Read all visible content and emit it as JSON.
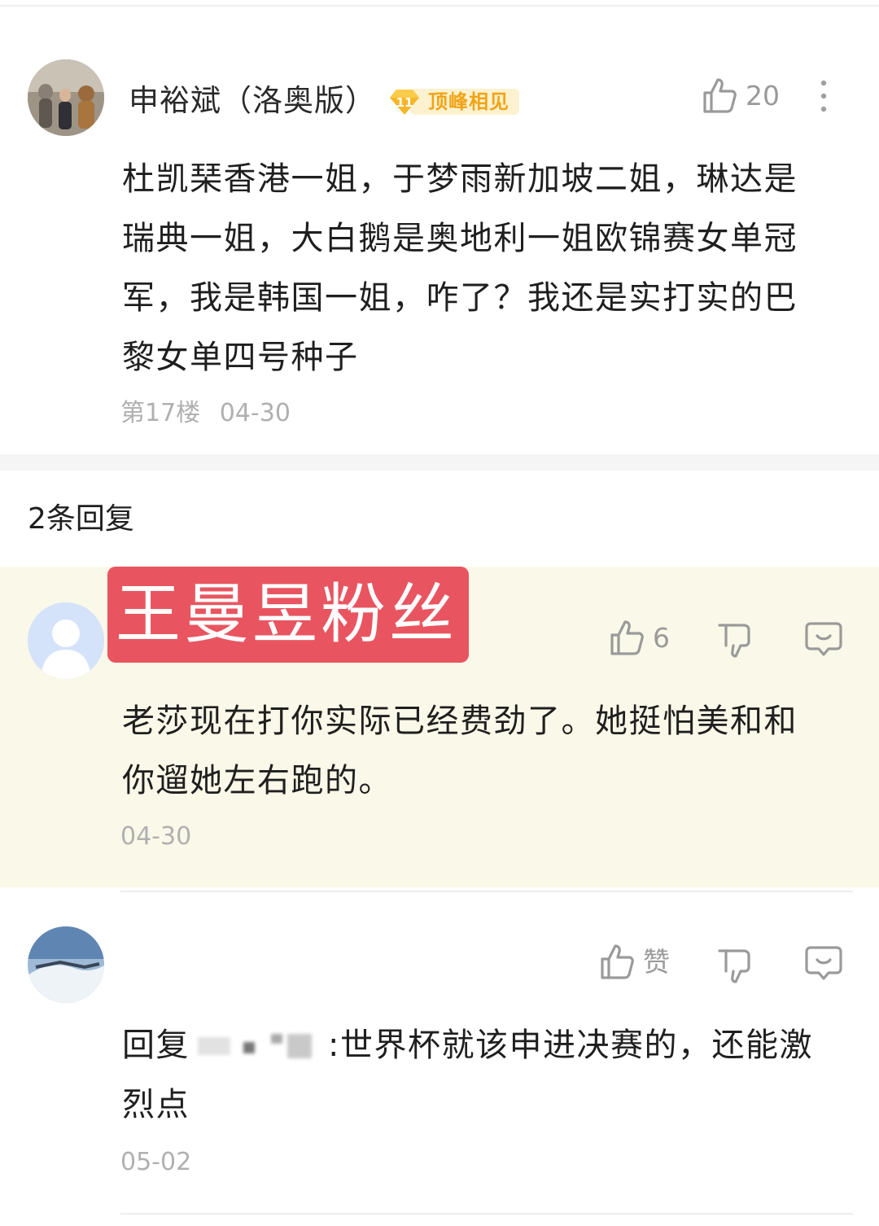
{
  "main_comment": {
    "author": "申裕斌（洛奥版）",
    "badge_level": "11",
    "badge_text": "顶峰相见",
    "likes": "20",
    "content": [
      "杜凯琹香港一姐，于梦雨新加坡二姐，琳达是",
      "瑞典一姐，大白鹅是奥地利一姐欧锦赛女单冠",
      "军，我是韩国一姐，咋了？我还是实打实的巴",
      "黎女单四号种子"
    ],
    "floor": "第17楼",
    "date": "04-30"
  },
  "replies_header": "2条回复",
  "replies": [
    {
      "author_tag": "王曼昱粉丝",
      "likes": "6",
      "content": [
        "老莎现在打你实际已经费劲了。她挺怕美和和",
        "你遛她左右跑的。"
      ],
      "date": "04-30"
    },
    {
      "author": "",
      "like_label": "赞",
      "content_prefix": "回复",
      "content": [
        ":世界杯就该申进决赛的，还能激",
        "烈点"
      ],
      "date": "05-02"
    }
  ],
  "colors": {
    "accent_tag": "#e85560",
    "highlight_bg": "#faf8e8",
    "badge_gold": "#f2a417"
  }
}
